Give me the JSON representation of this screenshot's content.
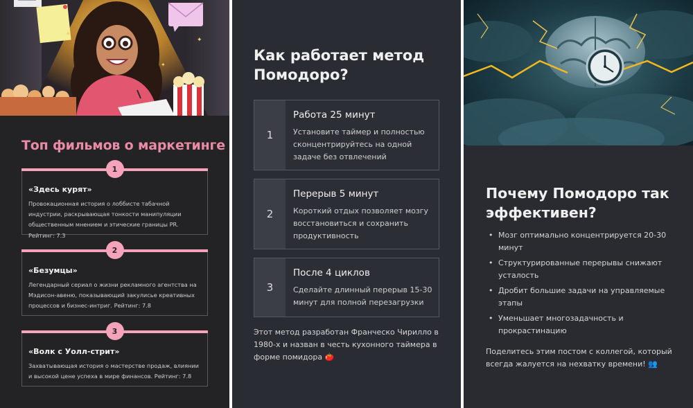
{
  "slide1": {
    "title": "Топ фильмов о маркетинге",
    "illustration": "cartoon-woman-with-glasses-popcorn-notes",
    "cards": [
      {
        "number": "1",
        "title": "«Здесь курят»",
        "text": "Провокационная история о лоббисте табачной индустрии, раскрывающая тонкости манипуляции общественным мнением и этические границы PR. Рейтинг: 7.3"
      },
      {
        "number": "2",
        "title": "«Безумцы»",
        "text": "Легендарный сериал о жизни рекламного агентства на Мэдисон-авеню, показывающий закулисье креативных процессов и бизнес-интриг. Рейтинг: 7.8"
      },
      {
        "number": "3",
        "title": "«Волк с Уолл-стрит»",
        "text": "Захватывающая история о мастерстве продаж, влиянии и высокой цене успеха в мире финансов. Рейтинг: 7.8"
      }
    ]
  },
  "slide2": {
    "title": "Как работает метод Помодоро?",
    "steps": [
      {
        "number": "1",
        "title": "Работа 25 минут",
        "text": "Установите таймер и полностью сконцентрируйтесь на одной задаче без отвлечений"
      },
      {
        "number": "2",
        "title": "Перерыв 5 минут",
        "text": "Короткий отдых позволяет мозгу восстановиться и сохранить продуктивность"
      },
      {
        "number": "3",
        "title": "После 4 циклов",
        "text": "Сделайте длинный перерыв 15-30 минут для полной перезагрузки"
      }
    ],
    "footer": "Этот метод разработан Франческо Чирилло в 1980-х и назван в честь кухонного таймера в форме помидора 🍅"
  },
  "slide3": {
    "illustration": "brain-with-clock-storm",
    "title": "Почему Помодоро так эффективен?",
    "bullets": [
      "Мозг оптимально концентрируется 20-30 минут",
      "Структурированные перерывы снижают усталость",
      "Дробит большие задачи на управляемые этапы",
      "Уменьшает многозадачность и прокрастинацию"
    ],
    "footer": "Поделитесь этим постом с коллегой, который всегда жалуется на нехватку времени! 👥"
  },
  "colors": {
    "accent_pink": "#f4a3ba",
    "title_pink": "#e98aa6",
    "slide_bg_dark": "#232224",
    "slide_bg_slate": "#2a2c33",
    "step_number_bg": "#3b3e47",
    "gold": "#f2b81e"
  }
}
